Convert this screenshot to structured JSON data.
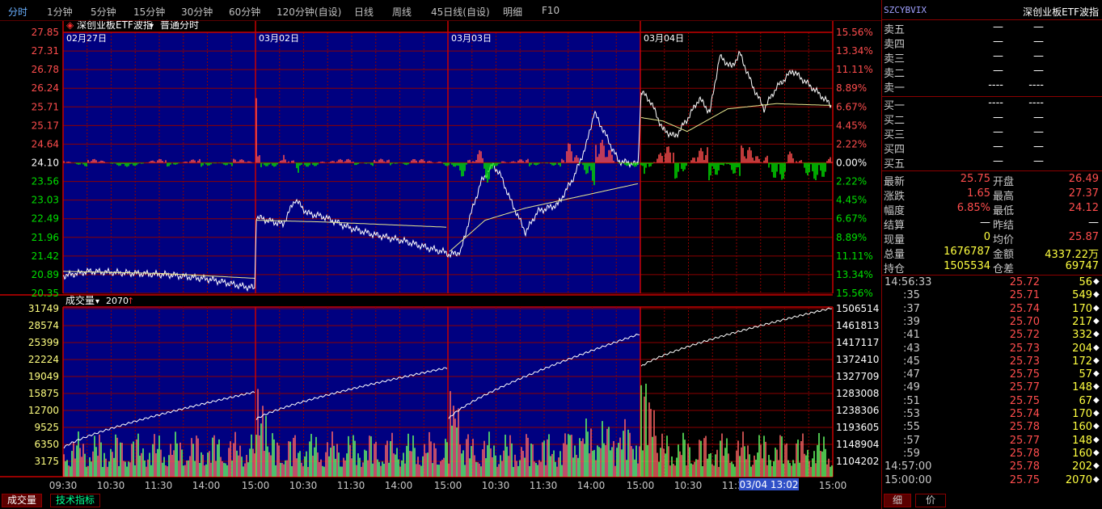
{
  "toolbar": {
    "periods": [
      "分时",
      "1分钟",
      "5分钟",
      "15分钟",
      "30分钟",
      "60分钟",
      "120分钟(自设)",
      "日线",
      "周线",
      "45日线(自设)",
      "明细",
      "F10"
    ],
    "active": "分时"
  },
  "price_panel": {
    "title": "深创业板ETF波指",
    "title_arrow": "▾",
    "mode": "普通分时",
    "day_labels": [
      "02月27日",
      "03月02日",
      "03月03日",
      "03月04日"
    ],
    "y_left": [
      "27.85",
      "27.31",
      "26.78",
      "26.24",
      "25.71",
      "25.17",
      "24.64",
      "24.10",
      "23.56",
      "23.03",
      "22.49",
      "21.96",
      "21.42",
      "20.89",
      "20.35"
    ],
    "y_right": [
      "15.56%",
      "13.34%",
      "11.11%",
      "8.89%",
      "6.67%",
      "4.45%",
      "2.22%",
      "0.00%",
      "2.22%",
      "4.45%",
      "6.67%",
      "8.89%",
      "11.11%",
      "13.34%",
      "15.56%"
    ]
  },
  "volume_panel": {
    "title": "成交量",
    "title_arrow": "▾",
    "value": "2070",
    "value_arrow": "↑",
    "y_left": [
      "31749",
      "28574",
      "25399",
      "22224",
      "19049",
      "15875",
      "12700",
      "9525",
      "6350",
      "3175"
    ],
    "y_right": [
      "1506514",
      "1461813",
      "1417117",
      "1372410",
      "1327709",
      "1283008",
      "1238306",
      "1193605",
      "1148904",
      "1104202"
    ]
  },
  "x_axis": [
    "09:30",
    "10:30",
    "11:30",
    "14:00",
    "15:00",
    "10:30",
    "11:30",
    "14:00",
    "15:00",
    "10:30",
    "11:30",
    "14:00",
    "15:00",
    "10:30",
    "11:30",
    "15:00"
  ],
  "cursor_label": "03/04 13:02",
  "bottom_tabs": [
    "成交量",
    "技术指标"
  ],
  "right_tabs": [
    "细",
    "价"
  ],
  "quote": {
    "code": "SZCYBVIX",
    "name": "深创业板ETF波指",
    "asks": [
      {
        "label": "卖五",
        "price": "—",
        "vol": "—"
      },
      {
        "label": "卖四",
        "price": "—",
        "vol": "—"
      },
      {
        "label": "卖三",
        "price": "—",
        "vol": "—"
      },
      {
        "label": "卖二",
        "price": "—",
        "vol": "—"
      },
      {
        "label": "卖一",
        "price": "----",
        "vol": "----"
      }
    ],
    "bids": [
      {
        "label": "买一",
        "price": "----",
        "vol": "----"
      },
      {
        "label": "买二",
        "price": "—",
        "vol": "—"
      },
      {
        "label": "买三",
        "price": "—",
        "vol": "—"
      },
      {
        "label": "买四",
        "price": "—",
        "vol": "—"
      },
      {
        "label": "买五",
        "price": "—",
        "vol": "—"
      }
    ],
    "stats": [
      {
        "l1": "最新",
        "v1": "25.75",
        "c1": "red",
        "l2": "开盘",
        "v2": "26.49",
        "c2": "red"
      },
      {
        "l1": "涨跌",
        "v1": "1.65",
        "c1": "red",
        "l2": "最高",
        "v2": "27.37",
        "c2": "red"
      },
      {
        "l1": "幅度",
        "v1": "6.85%",
        "c1": "red",
        "l2": "最低",
        "v2": "24.12",
        "c2": "red"
      },
      {
        "l1": "结算",
        "v1": "—",
        "c1": "white",
        "l2": "昨结",
        "v2": "—",
        "c2": "white"
      },
      {
        "l1": "现量",
        "v1": "0",
        "c1": "yellow",
        "l2": "均价",
        "v2": "25.87",
        "c2": "red"
      },
      {
        "l1": "总量",
        "v1": "1676787",
        "c1": "yellow",
        "l2": "金额",
        "v2": "4337.22万",
        "c2": "yellow"
      },
      {
        "l1": "持仓",
        "v1": "1505534",
        "c1": "yellow",
        "l2": "仓差",
        "v2": "69747",
        "c2": "yellow"
      }
    ],
    "ticks": [
      {
        "time": "14:56:33",
        "price": "25.72",
        "vol": "56",
        "arrow": "◆"
      },
      {
        "time": ":35",
        "price": "25.71",
        "vol": "549",
        "arrow": "◆"
      },
      {
        "time": ":37",
        "price": "25.74",
        "vol": "170",
        "arrow": "◆"
      },
      {
        "time": ":39",
        "price": "25.70",
        "vol": "217",
        "arrow": "◆"
      },
      {
        "time": ":41",
        "price": "25.72",
        "vol": "332",
        "arrow": "◆"
      },
      {
        "time": ":43",
        "price": "25.73",
        "vol": "204",
        "arrow": "◆"
      },
      {
        "time": ":45",
        "price": "25.73",
        "vol": "172",
        "arrow": "◆"
      },
      {
        "time": ":47",
        "price": "25.75",
        "vol": "57",
        "arrow": "◆"
      },
      {
        "time": ":49",
        "price": "25.77",
        "vol": "148",
        "arrow": "◆"
      },
      {
        "time": ":51",
        "price": "25.75",
        "vol": "67",
        "arrow": "◆"
      },
      {
        "time": ":53",
        "price": "25.74",
        "vol": "170",
        "arrow": "◆"
      },
      {
        "time": ":55",
        "price": "25.78",
        "vol": "160",
        "arrow": "◆"
      },
      {
        "time": ":57",
        "price": "25.77",
        "vol": "148",
        "arrow": "◆"
      },
      {
        "time": ":59",
        "price": "25.78",
        "vol": "160",
        "arrow": "◆"
      },
      {
        "time": "14:57:00",
        "price": "25.78",
        "vol": "202",
        "arrow": "◆"
      },
      {
        "time": "15:00:00",
        "price": "25.75",
        "vol": "2070",
        "arrow": "◆"
      }
    ]
  },
  "colors": {
    "blue_bg": "#000080",
    "grid": "#8b0000",
    "up": "#ff4d4d",
    "down": "#00e000",
    "price_line": "#ffffff",
    "avg_line": "#e8e890",
    "bar_up": "#ff6666",
    "bar_down": "#66ff66"
  }
}
